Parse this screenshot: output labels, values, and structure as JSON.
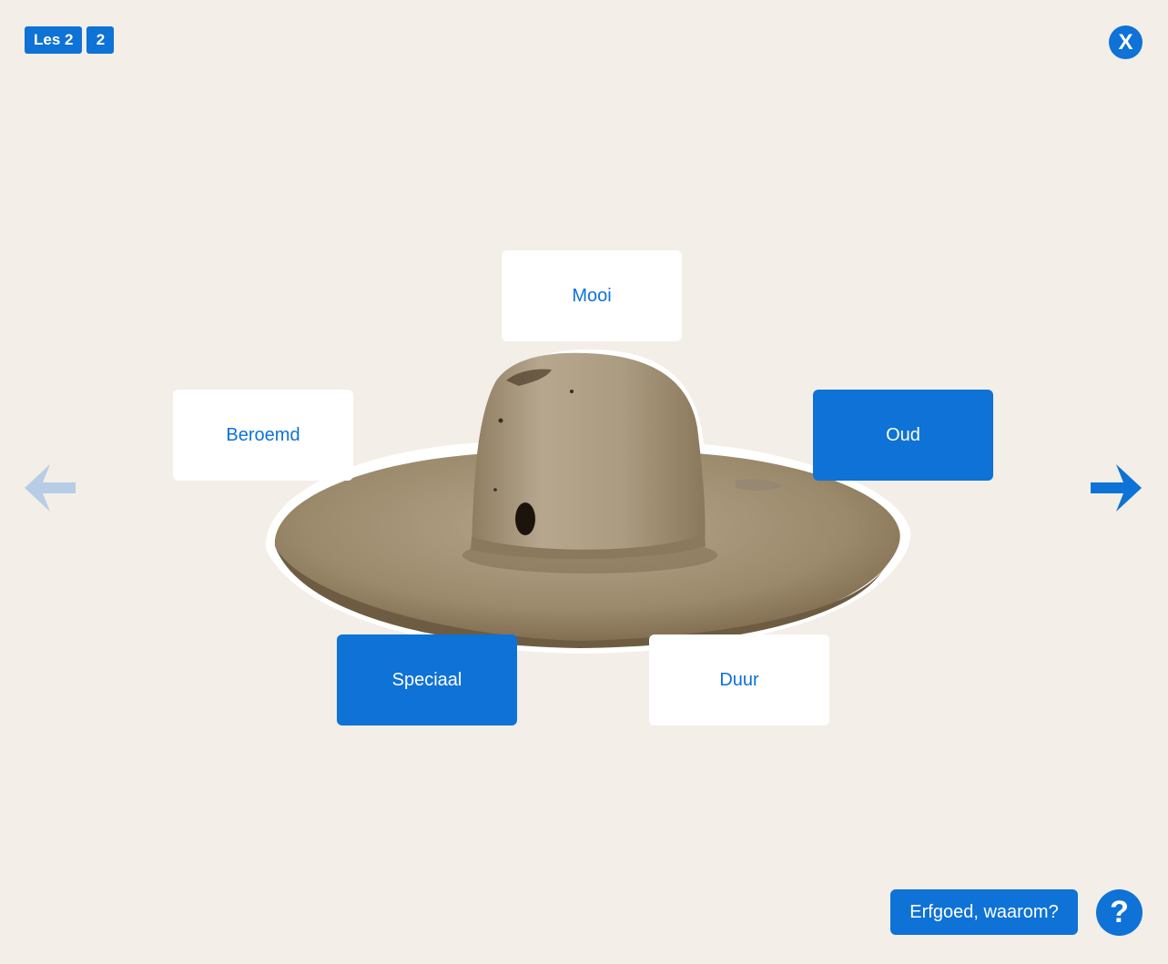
{
  "lesson": {
    "label": "Les 2",
    "number": "2"
  },
  "close_label": "X",
  "navigation": {
    "prev_icon": "arrow-left-icon",
    "next_icon": "arrow-right-icon",
    "prev_enabled": false,
    "next_enabled": true
  },
  "object": {
    "image": "hat-image"
  },
  "tags": {
    "mooi": {
      "label": "Mooi",
      "selected": false
    },
    "beroemd": {
      "label": "Beroemd",
      "selected": false
    },
    "oud": {
      "label": "Oud",
      "selected": true
    },
    "speciaal": {
      "label": "Speciaal",
      "selected": true
    },
    "duur": {
      "label": "Duur",
      "selected": false
    }
  },
  "footer": {
    "why_button": "Erfgoed, waarom?",
    "help_label": "?"
  },
  "colors": {
    "accent": "#0e72d6",
    "accent_disabled": "#b7cde6",
    "background": "#f3eee7",
    "tag_unselected": "#ffffff"
  }
}
